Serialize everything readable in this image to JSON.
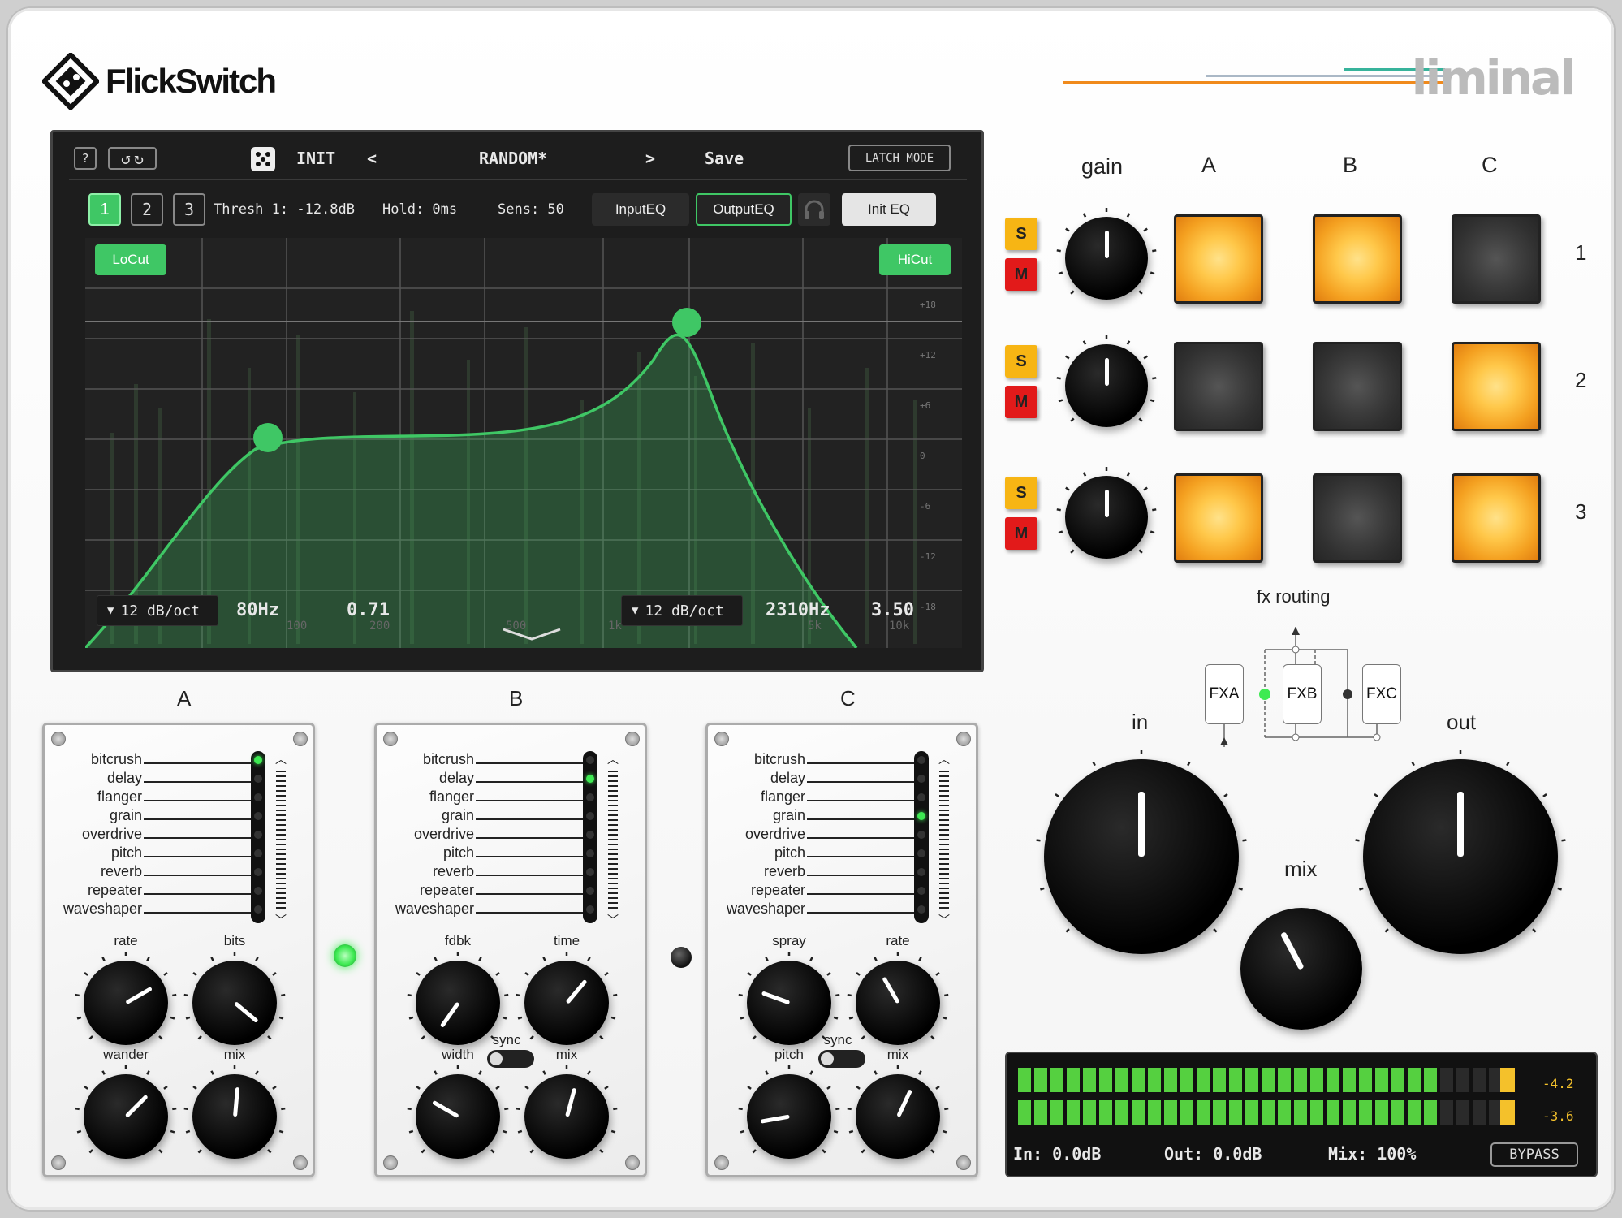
{
  "brand": {
    "logo_text": "FlickSwitch",
    "product": "liminal"
  },
  "colors": {
    "accent_green": "#3fc765",
    "pad_on": "#f4a020",
    "solo": "#f7b514",
    "mute": "#e21a1a"
  },
  "toolbar": {
    "help_label": "?",
    "preset_init": "INIT",
    "prev_label": "<",
    "preset_name": "RANDOM*",
    "next_label": ">",
    "save_label": "Save",
    "latch_label": "LATCH MODE"
  },
  "eq_header": {
    "band1": "1",
    "band2": "2",
    "band3": "3",
    "thresh": "Thresh 1: -12.8dB",
    "hold": "Hold: 0ms",
    "sens": "Sens: 50",
    "input_eq": "InputEQ",
    "output_eq": "OutputEQ",
    "init_eq": "Init EQ"
  },
  "eq": {
    "locut_label": "LoCut",
    "hicut_label": "HiCut",
    "db_scale": [
      "+18",
      "+12",
      "+6",
      "0",
      "-6",
      "-12",
      "-18"
    ],
    "freq_labels": [
      "100",
      "200",
      "500",
      "1k",
      "5k",
      "10k"
    ],
    "lo_slope": "12 dB/oct",
    "lo_freq": "80Hz",
    "lo_q": "0.71",
    "hi_slope": "12 dB/oct",
    "hi_freq": "2310Hz",
    "hi_q": "3.50"
  },
  "matrix": {
    "headers": [
      "gain",
      "A",
      "B",
      "C"
    ],
    "solo_label": "S",
    "mute_label": "M",
    "rows": [
      {
        "num": "1",
        "pads": [
          "on",
          "on",
          "off"
        ]
      },
      {
        "num": "2",
        "pads": [
          "off",
          "off",
          "on"
        ]
      },
      {
        "num": "3",
        "pads": [
          "on",
          "off",
          "on"
        ]
      }
    ]
  },
  "fx_effects": [
    "bitcrush",
    "delay",
    "flanger",
    "grain",
    "overdrive",
    "pitch",
    "reverb",
    "repeater",
    "waveshaper"
  ],
  "panels": [
    {
      "title": "A",
      "selected_index": 0,
      "knobs": [
        "rate",
        "bits",
        "wander",
        "mix"
      ],
      "sync_label": ""
    },
    {
      "title": "B",
      "selected_index": 1,
      "knobs": [
        "fdbk",
        "time",
        "width",
        "mix"
      ],
      "sync_label": "sync"
    },
    {
      "title": "C",
      "selected_index": 3,
      "knobs": [
        "spray",
        "rate",
        "pitch",
        "mix"
      ],
      "sync_label": "sync"
    }
  ],
  "routing": {
    "title": "fx routing",
    "nodes": [
      "FXA",
      "FXB",
      "FXC"
    ]
  },
  "master": {
    "in_label": "in",
    "out_label": "out",
    "mix_label": "mix"
  },
  "meter": {
    "peak1": "-4.2",
    "peak2": "-3.6",
    "in_text": "In: 0.0dB",
    "out_text": "Out: 0.0dB",
    "mix_text": "Mix: 100%",
    "bypass_label": "BYPASS",
    "level1": 0.86,
    "level2": 0.86
  }
}
